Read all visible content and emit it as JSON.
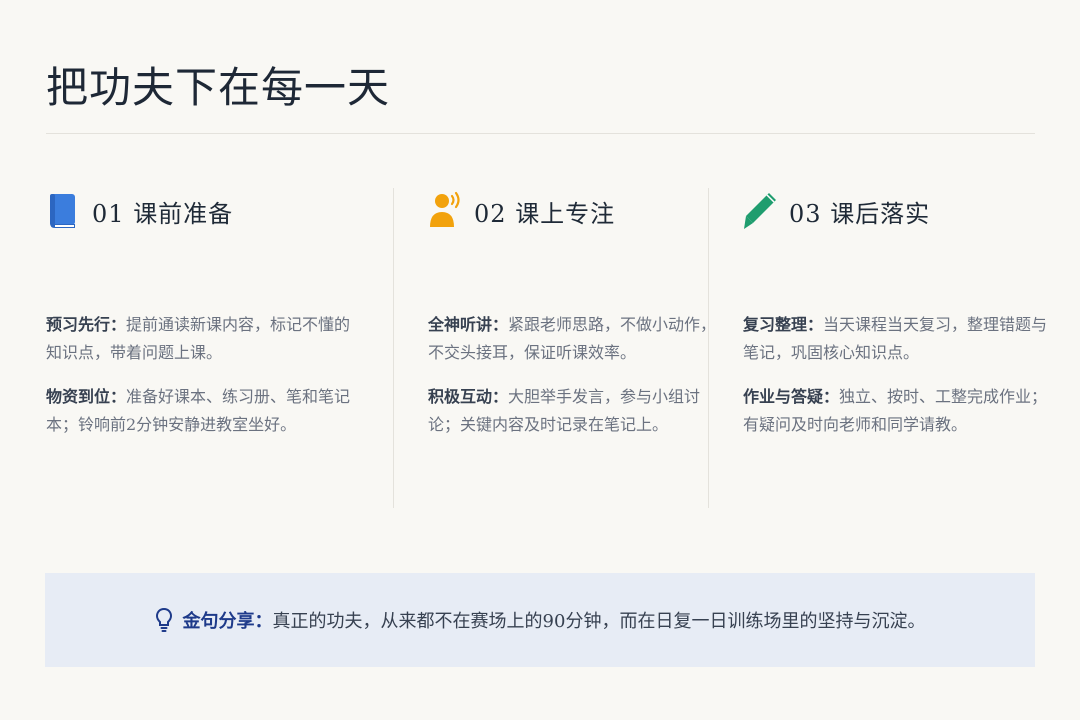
{
  "page": {
    "title": "把功夫下在每一天"
  },
  "columns": [
    {
      "number": "01",
      "title": "课前准备",
      "icon": "book-icon",
      "icon_color": "#3b7ddd",
      "items": [
        {
          "label": "预习先行：",
          "text": "提前通读新课内容，标记不懂的知识点，带着问题上课。"
        },
        {
          "label": "物资到位：",
          "text": "准备好课本、练习册、笔和笔记本；铃响前2分钟安静进教室坐好。"
        }
      ]
    },
    {
      "number": "02",
      "title": "课上专注",
      "icon": "speaking-person-icon",
      "icon_color": "#f2a20c",
      "items": [
        {
          "label": "全神听讲：",
          "text": "紧跟老师思路，不做小动作，不交头接耳，保证听课效率。"
        },
        {
          "label": "积极互动：",
          "text": "大胆举手发言，参与小组讨论；关键内容及时记录在笔记上。"
        }
      ]
    },
    {
      "number": "03",
      "title": "课后落实",
      "icon": "pencil-icon",
      "icon_color": "#1f9d6e",
      "items": [
        {
          "label": "复习整理：",
          "text": "当天课程当天复习，整理错题与笔记，巩固核心知识点。"
        },
        {
          "label": "作业与答疑：",
          "text": "独立、按时、工整完成作业；有疑问及时向老师和同学请教。"
        }
      ]
    }
  ],
  "quote": {
    "icon": "lightbulb-icon",
    "icon_color": "#1e3a8a",
    "label": "金句分享：",
    "text": "真正的功夫，从来都不在赛场上的90分钟，而在日复一日训练场里的坚持与沉淀。"
  }
}
